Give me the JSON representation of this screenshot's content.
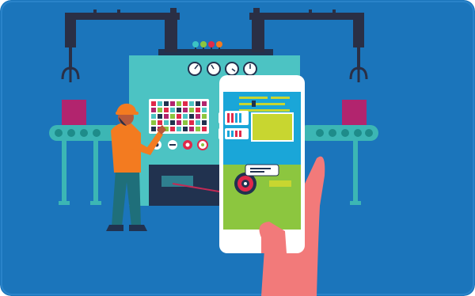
{
  "scene": {
    "subject": "industrial-iot-machine-monitoring",
    "icons": [
      "robot-arm-left-icon",
      "robot-arm-right-icon",
      "conveyor-belt-icon",
      "control-panel-icon",
      "gauge-icon",
      "worker-icon",
      "smartphone-icon",
      "hand-icon",
      "target-icon"
    ],
    "colors": {
      "background": "#1b75bb",
      "frame_border": "#2a83c9",
      "machine": "#4cc3c3",
      "machine_dark": "#21324f",
      "arm": "#2a2f45",
      "conveyor": "#3cb6b4",
      "conveyor_dark": "#1e8c8a",
      "box_magenta": "#b2246e",
      "worker_shirt": "#f37b20",
      "worker_pants": "#1f6f7a",
      "hand": "#f27a7a",
      "phone": "#ffffff",
      "phone_screen_top": "#1aa6d8",
      "phone_screen_bottom": "#8cc63f",
      "accent_lime": "#c8d630",
      "accent_red": "#e0294a"
    }
  }
}
